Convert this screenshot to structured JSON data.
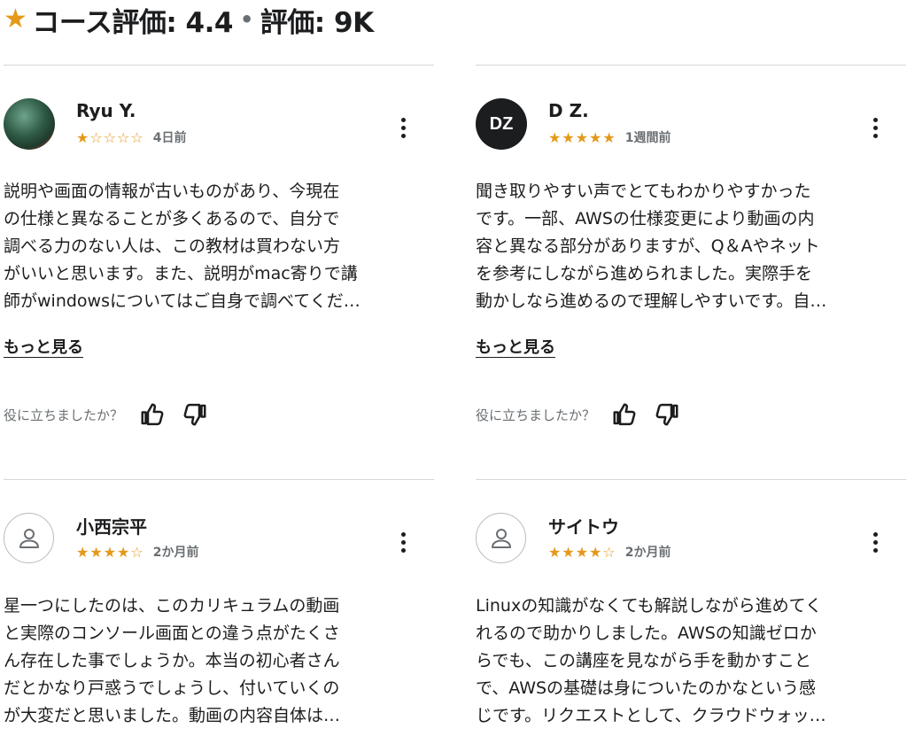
{
  "header": {
    "star": "★",
    "title": "コース評価: 4.4",
    "dot": "•",
    "count": "評価: 9K"
  },
  "helpful_label": "役に立ちましたか？",
  "more_label": "もっと見る",
  "reviews": [
    {
      "name": "Ryu Y.",
      "avatar": "",
      "stars": "★☆☆☆☆",
      "rating": 1,
      "date": "4日前",
      "lines": [
        "説明や画面の情報が古いものがあり、今現在",
        "の仕様と異なることが多くあるので、自分で",
        "調べる力のない人は、この教材は買わない方",
        "がいいと思います。また、説明がmac寄りで講",
        "師がwindowsについてはご自身で調べてくだ…"
      ]
    },
    {
      "name": "D Z.",
      "avatar": "DZ",
      "stars": "★★★★★",
      "rating": 5,
      "date": "1週間前",
      "lines": [
        "聞き取りやすい声でとてもわかりやすかった",
        "です。一部、AWSの仕様変更により動画の内",
        "容と異なる部分がありますが、Q＆Aやネット",
        "を参考にしながら進められました。実際手を",
        "動かしなら進めるので理解しやすいです。自…"
      ]
    },
    {
      "name": "小西宗平",
      "avatar": "",
      "stars": "★★★★☆",
      "rating": 4,
      "date": "2か月前",
      "lines": [
        "星一つにしたのは、このカリキュラムの動画",
        "と実際のコンソール画面との違う点がたくさ",
        "ん存在した事でしょうか。本当の初心者さん",
        "だとかなり戸惑うでしょうし、付いていくの",
        "が大変だと思いました。動画の内容自体は…"
      ]
    },
    {
      "name": "サイトウ",
      "avatar": "",
      "stars": "★★★★☆",
      "rating": 4,
      "date": "2か月前",
      "lines": [
        "Linuxの知識がなくても解説しながら進めてく",
        "れるので助かりしました。AWSの知識ゼロか",
        "らでも、この講座を見ながら手を動かすこと",
        "で、AWSの基礎は身についたのかなという感",
        "じです。リクエストとして、クラウドウォッ…"
      ]
    }
  ]
}
